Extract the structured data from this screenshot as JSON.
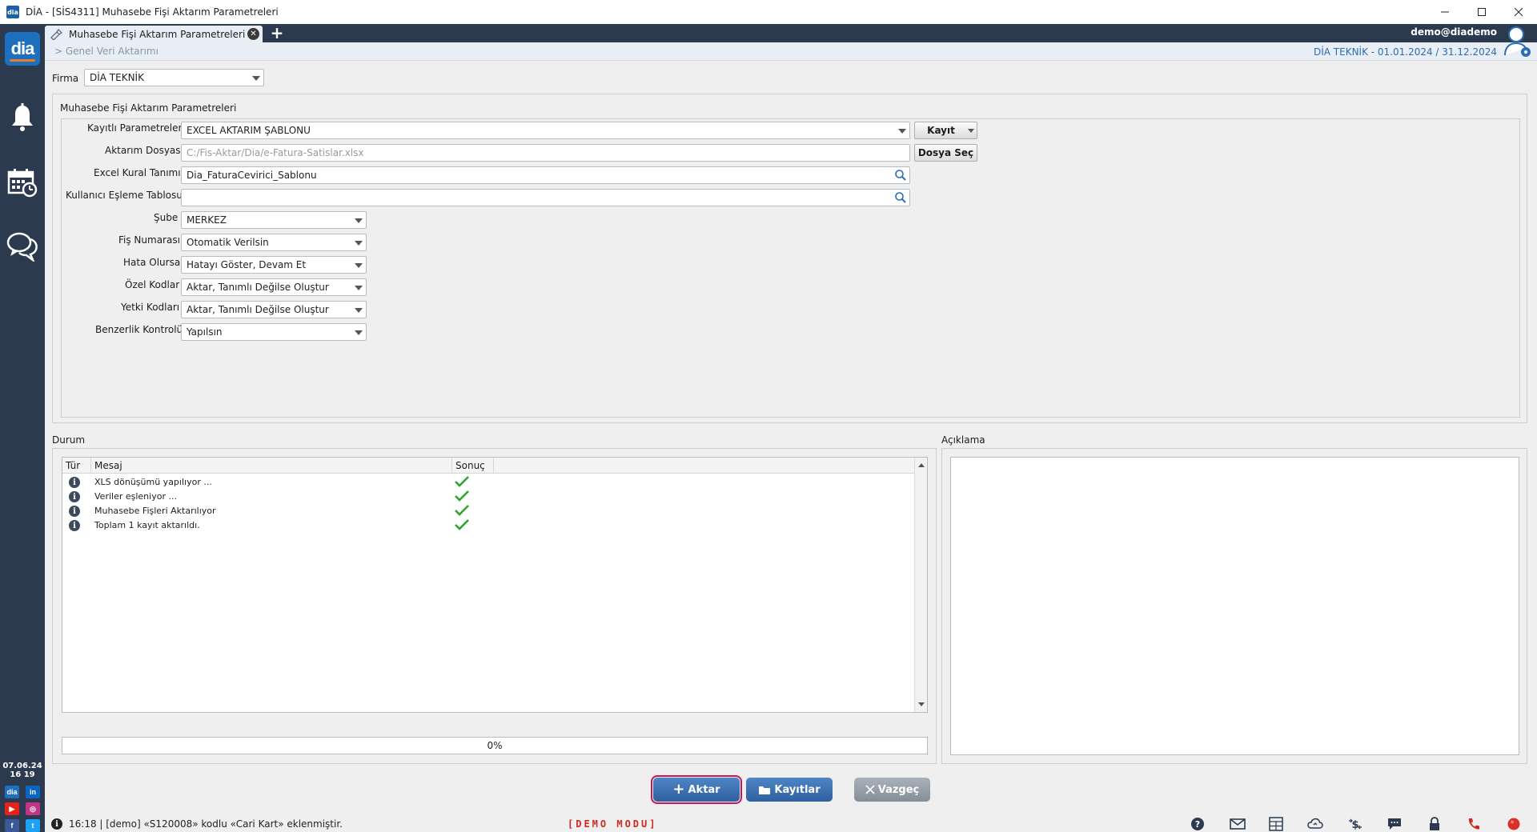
{
  "window": {
    "title": "DİA - [SİS4311] Muhasebe Fişi Aktarım Parametreleri",
    "app_icon_text": "dia",
    "controls": [
      "minimize",
      "maximize",
      "close"
    ]
  },
  "sidebar": {
    "logo": "dia",
    "icons": [
      "bell-icon",
      "calendar-icon",
      "chat-icon"
    ],
    "date": "07.06.24",
    "time": "16 19",
    "social": [
      {
        "name": "dia",
        "color": "#1f6fbf"
      },
      {
        "name": "in",
        "color": "#0a66c2"
      },
      {
        "name": "▶",
        "color": "#e62117"
      },
      {
        "name": "◎",
        "color": "#c13584"
      },
      {
        "name": "f",
        "color": "#3b5998"
      },
      {
        "name": "t",
        "color": "#1da1f2"
      }
    ]
  },
  "tabbar": {
    "active_tab": "Muhasebe Fişi Aktarım Parametreleri",
    "add_label": "+",
    "user": "demo@diademo"
  },
  "subheader": {
    "breadcrumb": "> Genel Veri Aktarımı",
    "period": "DİA TEKNİK -  01.01.2024 / 31.12.2024"
  },
  "firma": {
    "label": "Firma",
    "value": "DİA TEKNİK"
  },
  "params": {
    "group_title": "Muhasebe Fişi Aktarım Parametreleri",
    "kayitli_label": "Kayıtlı Parametreler",
    "kayitli_value": "EXCEL AKTARIM ŞABLONU",
    "kayit_button": "Kayıt",
    "aktarim_label": "Aktarım Dosyası",
    "aktarim_value": "C:/Fis-Aktar/Dia/e-Fatura-Satislar.xlsx",
    "dosya_sec_button": "Dosya Seç",
    "excel_label": "Excel Kural Tanımı",
    "excel_value": "Dia_FaturaCevirici_Sablonu",
    "kullanici_label": "Kullanıcı Eşleme Tablosu",
    "kullanici_value": "",
    "sube_label": "Şube",
    "sube_value": "MERKEZ",
    "fis_label": "Fiş Numarası",
    "fis_value": "Otomatik Verilsin",
    "hata_label": "Hata Olursa",
    "hata_value": "Hatayı Göster, Devam Et",
    "ozel_label": "Özel Kodlar",
    "ozel_value": "Aktar, Tanımlı Değilse Oluştur",
    "yetki_label": "Yetki Kodları",
    "yetki_value": "Aktar, Tanımlı Değilse Oluştur",
    "benzerlik_label": "Benzerlik Kontrolü",
    "benzerlik_value": "Yapılsın"
  },
  "durum": {
    "title": "Durum",
    "columns": [
      "Tür",
      "Mesaj",
      "Sonuç"
    ],
    "rows": [
      {
        "type": "info",
        "message": "XLS dönüşümü yapılıyor ...",
        "result": "ok"
      },
      {
        "type": "info",
        "message": "Veriler eşleniyor ...",
        "result": "ok"
      },
      {
        "type": "info",
        "message": "Muhasebe Fişleri Aktarılıyor",
        "result": "ok"
      },
      {
        "type": "info",
        "message": "Toplam 1 kayıt aktarıldı.",
        "result": "ok"
      }
    ],
    "progress_percent": 0,
    "progress_label": "0%"
  },
  "aciklama": {
    "title": "Açıklama",
    "text": ""
  },
  "buttons": {
    "aktar": "Aktar",
    "kayitlar": "Kayıtlar",
    "vazgec": "Vazgeç"
  },
  "statusbar": {
    "message": "16:18 | [demo] «S120008» kodlu «Cari Kart» eklenmiştir.",
    "mode": "[DEMO  MODU]",
    "icons": [
      "help-icon",
      "mail-icon",
      "calculator-icon",
      "cloud-sync-icon",
      "currency-icon",
      "message-icon",
      "lock-icon",
      "phone-icon",
      "record-icon"
    ]
  },
  "colors": {
    "sidebar": "#2b3a4f",
    "accent_blue": "#2f5f9e",
    "demo_red": "#cc2a1f",
    "focus_outline": "#c2185b",
    "check_green": "#2fa52f"
  }
}
